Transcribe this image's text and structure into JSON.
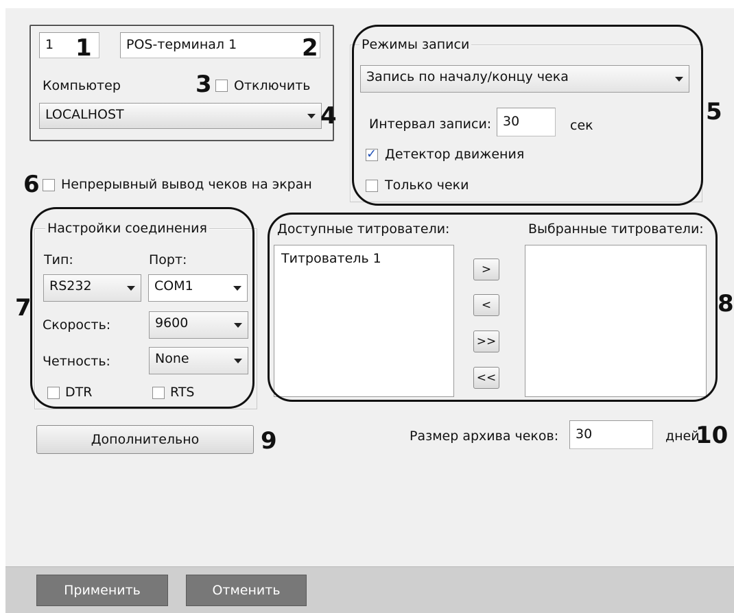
{
  "terminal": {
    "id": "1",
    "name": "POS-терминал 1",
    "computer_label": "Компьютер",
    "disable_label": "Отключить",
    "disable_checked": false,
    "computer_value": "LOCALHOST"
  },
  "continuous_output": {
    "label": "Непрерывный вывод чеков на экран",
    "checked": false
  },
  "recording": {
    "title": "Режимы записи",
    "mode_value": "Запись по началу/концу чека",
    "interval_label": "Интервал записи:",
    "interval_value": "30",
    "interval_unit": "сек",
    "motion_label": "Детектор движения",
    "motion_checked": true,
    "receipts_only_label": "Только чеки",
    "receipts_only_checked": false
  },
  "connection": {
    "title": "Настройки соединения",
    "type_label": "Тип:",
    "type_value": "RS232",
    "port_label": "Порт:",
    "port_value": "COM1",
    "speed_label": "Скорость:",
    "speed_value": "9600",
    "parity_label": "Четность:",
    "parity_value": "None",
    "dtr_label": "DTR",
    "dtr_checked": false,
    "rts_label": "RTS",
    "rts_checked": false
  },
  "titlers": {
    "available_label": "Доступные титрователи:",
    "selected_label": "Выбранные титрователи:",
    "available_items": [
      "Титрователь 1"
    ],
    "selected_items": [],
    "add_label": ">",
    "remove_label": "<",
    "add_all_label": ">>",
    "remove_all_label": "<<"
  },
  "advanced_button": "Дополнительно",
  "archive": {
    "label": "Размер архива чеков:",
    "value": "30",
    "unit": "дней"
  },
  "footer": {
    "apply_label": "Применить",
    "cancel_label": "Отменить"
  },
  "markers": [
    "1",
    "2",
    "3",
    "4",
    "5",
    "6",
    "7",
    "8",
    "9",
    "10"
  ]
}
